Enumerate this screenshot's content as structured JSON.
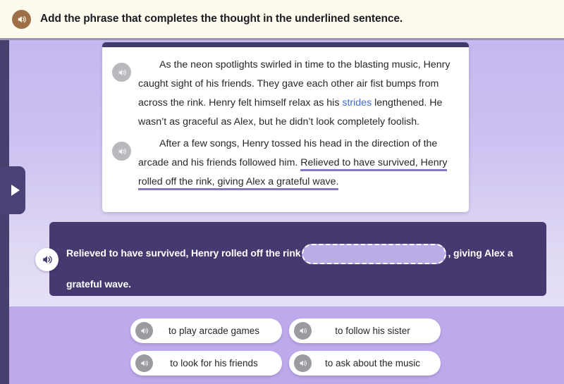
{
  "header": {
    "title": "Add the phrase that completes the thought in the underlined sentence.",
    "speaker_icon": "speaker-icon",
    "bg_color": "#FDFAEE",
    "icon_color": "#9E6F47"
  },
  "drawer": {
    "toggle_icon": "play-triangle-icon",
    "color": "#4A4277"
  },
  "passage": {
    "speaker_icon": "speaker-icon",
    "paragraphs": [
      {
        "id": "p1",
        "segments": [
          {
            "type": "text",
            "text": "As the neon spotlights swirled in time to the blasting music, Henry caught sight of his friends. They gave each other air fist bumps from across the rink. Henry felt himself relax as his "
          },
          {
            "type": "vocab",
            "text": "strides"
          },
          {
            "type": "text",
            "text": " lengthened. He wasn’t as graceful as Alex, but he didn’t look completely foolish."
          }
        ]
      },
      {
        "id": "p2",
        "segments": [
          {
            "type": "text",
            "text": "After a few songs, Henry tossed his head in the direction of the arcade and his friends followed him. "
          },
          {
            "type": "underlined",
            "text": "Relieved to have survived, Henry rolled off the rink, giving Alex a grateful wave."
          }
        ]
      }
    ],
    "vocab_word": "strides",
    "vocab_color": "#3C6FD2",
    "underline_color": "#8878C4"
  },
  "answer_bar": {
    "speaker_icon": "speaker-icon",
    "text_before": "Relieved to have survived, Henry rolled off the rink",
    "blank_value": "",
    "blank_placeholder": "",
    "text_after": ", giving Alex a grateful wave.",
    "bg_color": "#45396F",
    "blank_fill": "#BCACE6"
  },
  "choices": {
    "speaker_icon": "speaker-icon",
    "items": [
      {
        "id": "c1",
        "label": "to play arcade games"
      },
      {
        "id": "c2",
        "label": "to follow his sister"
      },
      {
        "id": "c3",
        "label": "to look for his friends"
      },
      {
        "id": "c4",
        "label": "to ask about the music"
      }
    ]
  },
  "colors": {
    "rail": "#47406E",
    "bg_top": "#C5B8EF",
    "bg_bottom": "#BCAAEA",
    "card_topbar": "#413B6B"
  }
}
